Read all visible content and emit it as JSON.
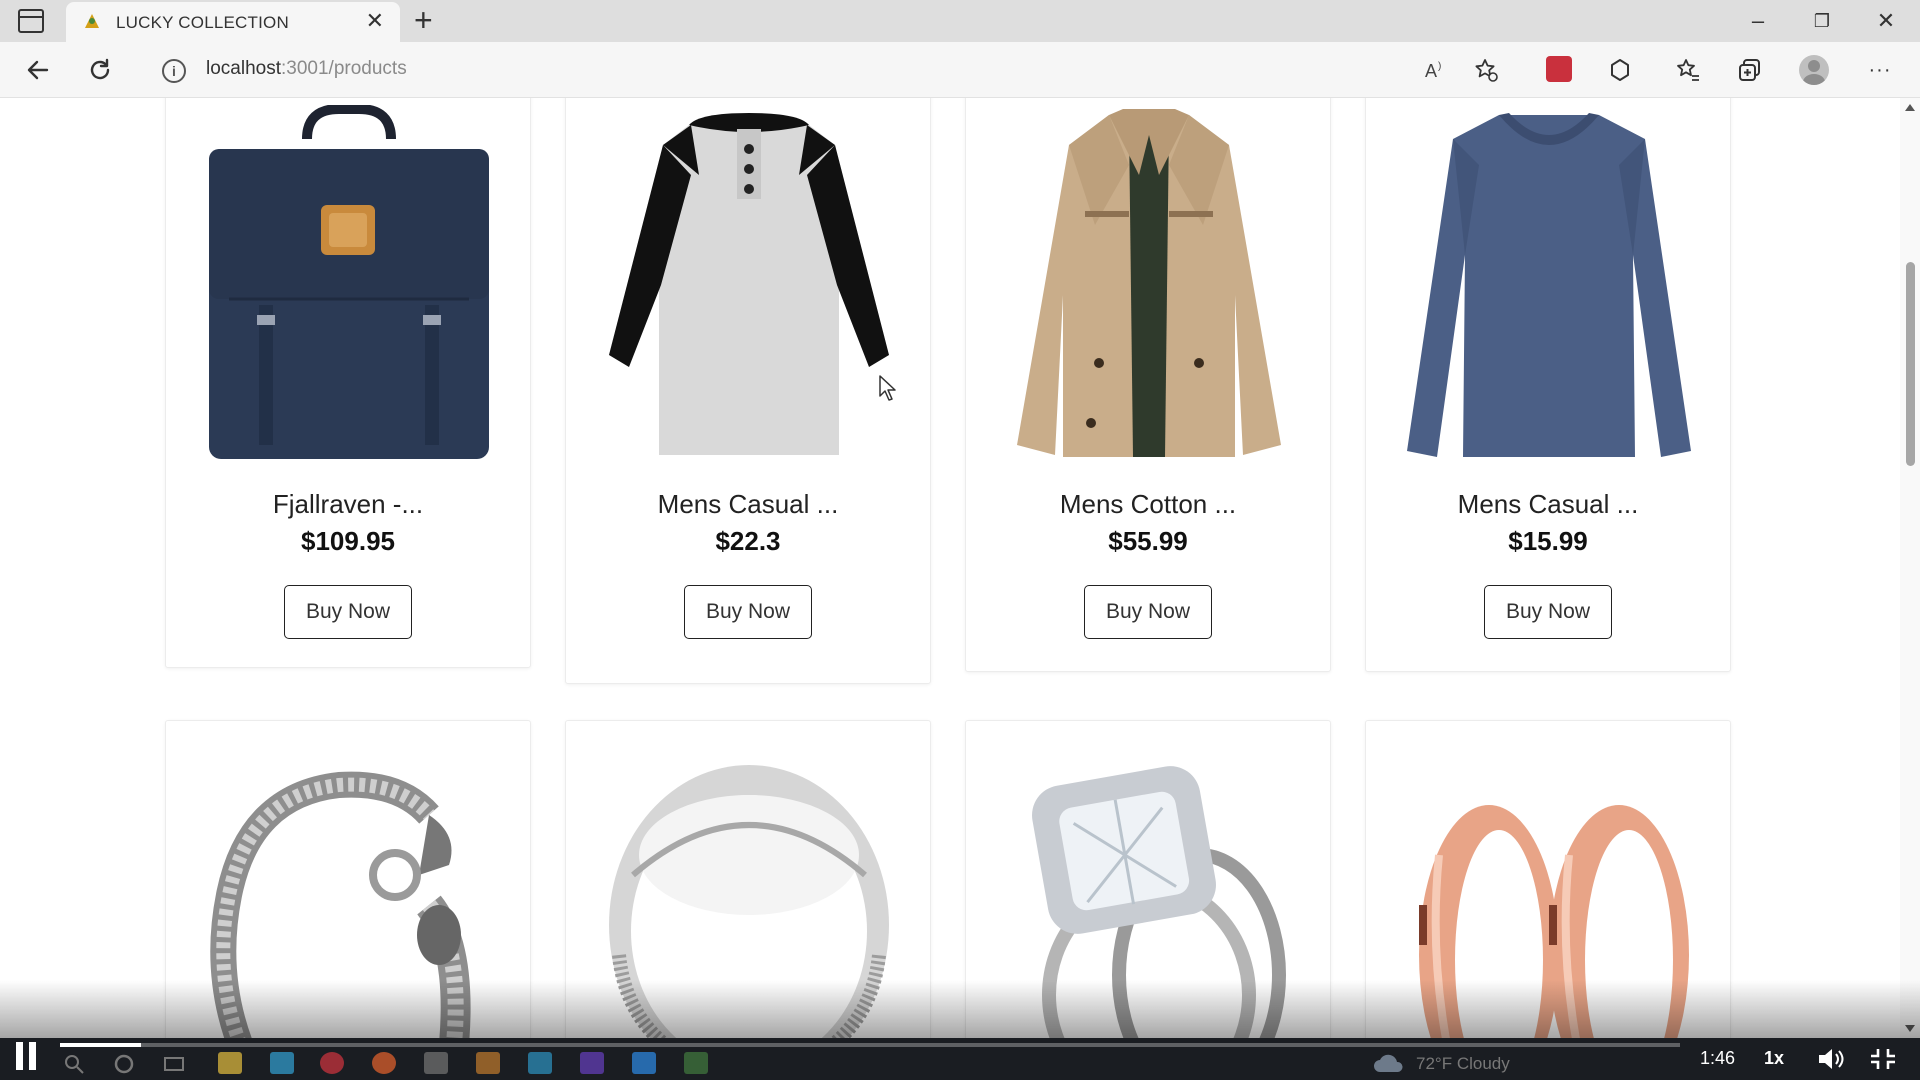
{
  "browser": {
    "tab_title": "LUCKY COLLECTION",
    "tab_close": "✕",
    "new_tab": "+",
    "address_host": "localhost",
    "address_rest": ":3001/products",
    "window_controls": {
      "minimize": "–",
      "restore": "❐",
      "close": "✕"
    },
    "toolbar_icons": [
      "back-icon",
      "refresh-icon",
      "site-info-icon",
      "read-aloud-icon",
      "favorite-add-icon",
      "extension-icon",
      "extensions-icon",
      "favorites-icon",
      "collections-icon",
      "profile-icon",
      "more-icon"
    ]
  },
  "products": [
    {
      "title": "Fjallraven -...",
      "price": "$109.95",
      "button": "Buy Now",
      "image": "backpack"
    },
    {
      "title": "Mens Casual ...",
      "price": "$22.3",
      "button": "Buy Now",
      "image": "raglan-tshirt"
    },
    {
      "title": "Mens Cotton ...",
      "price": "$55.99",
      "button": "Buy Now",
      "image": "cotton-jacket"
    },
    {
      "title": "Mens Casual ...",
      "price": "$15.99",
      "button": "Buy Now",
      "image": "longsleeve-shirt"
    },
    {
      "image": "dragon-bracelet"
    },
    {
      "image": "silver-ring"
    },
    {
      "image": "diamond-ring"
    },
    {
      "image": "rose-gold-rings"
    }
  ],
  "player": {
    "time": "1:46",
    "speed": "1x",
    "progress": 0.05
  },
  "taskbar": {
    "weather": "72°F Cloudy"
  },
  "colors": {
    "navy_backpack": "#2b3a55",
    "jacket_tan": "#c9ad8a",
    "shirt_blue": "#4b5f86",
    "rose_gold": "#e8a487"
  }
}
